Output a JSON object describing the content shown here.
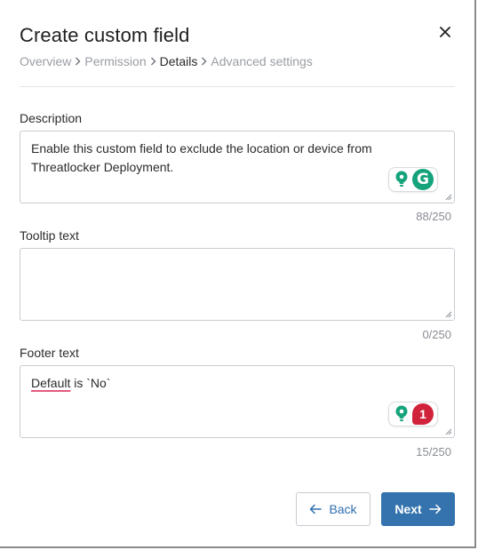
{
  "dialog": {
    "title": "Create custom field",
    "close_icon": "close-icon"
  },
  "breadcrumb": {
    "items": [
      "Overview",
      "Permission",
      "Details",
      "Advanced settings"
    ],
    "active_index": 2,
    "separator_icon": "chevron-right-icon"
  },
  "description": {
    "label": "Description",
    "value": "Enable this custom field to exclude the location or device from Threatlocker Deployment.",
    "counter": "88/250",
    "assistant_badge": "G"
  },
  "tooltip": {
    "label": "Tooltip text",
    "value": "",
    "counter": "0/250"
  },
  "footer": {
    "label": "Footer text",
    "value_underlined": "Default",
    "value_rest": " is `No`",
    "counter": "15/250",
    "issue_count": "1"
  },
  "actions": {
    "back_label": "Back",
    "next_label": "Next"
  },
  "colors": {
    "primary": "#3473ae",
    "grammar_green": "#15a37b",
    "issue_red": "#d1223c",
    "muted_text": "#9a9da3"
  }
}
